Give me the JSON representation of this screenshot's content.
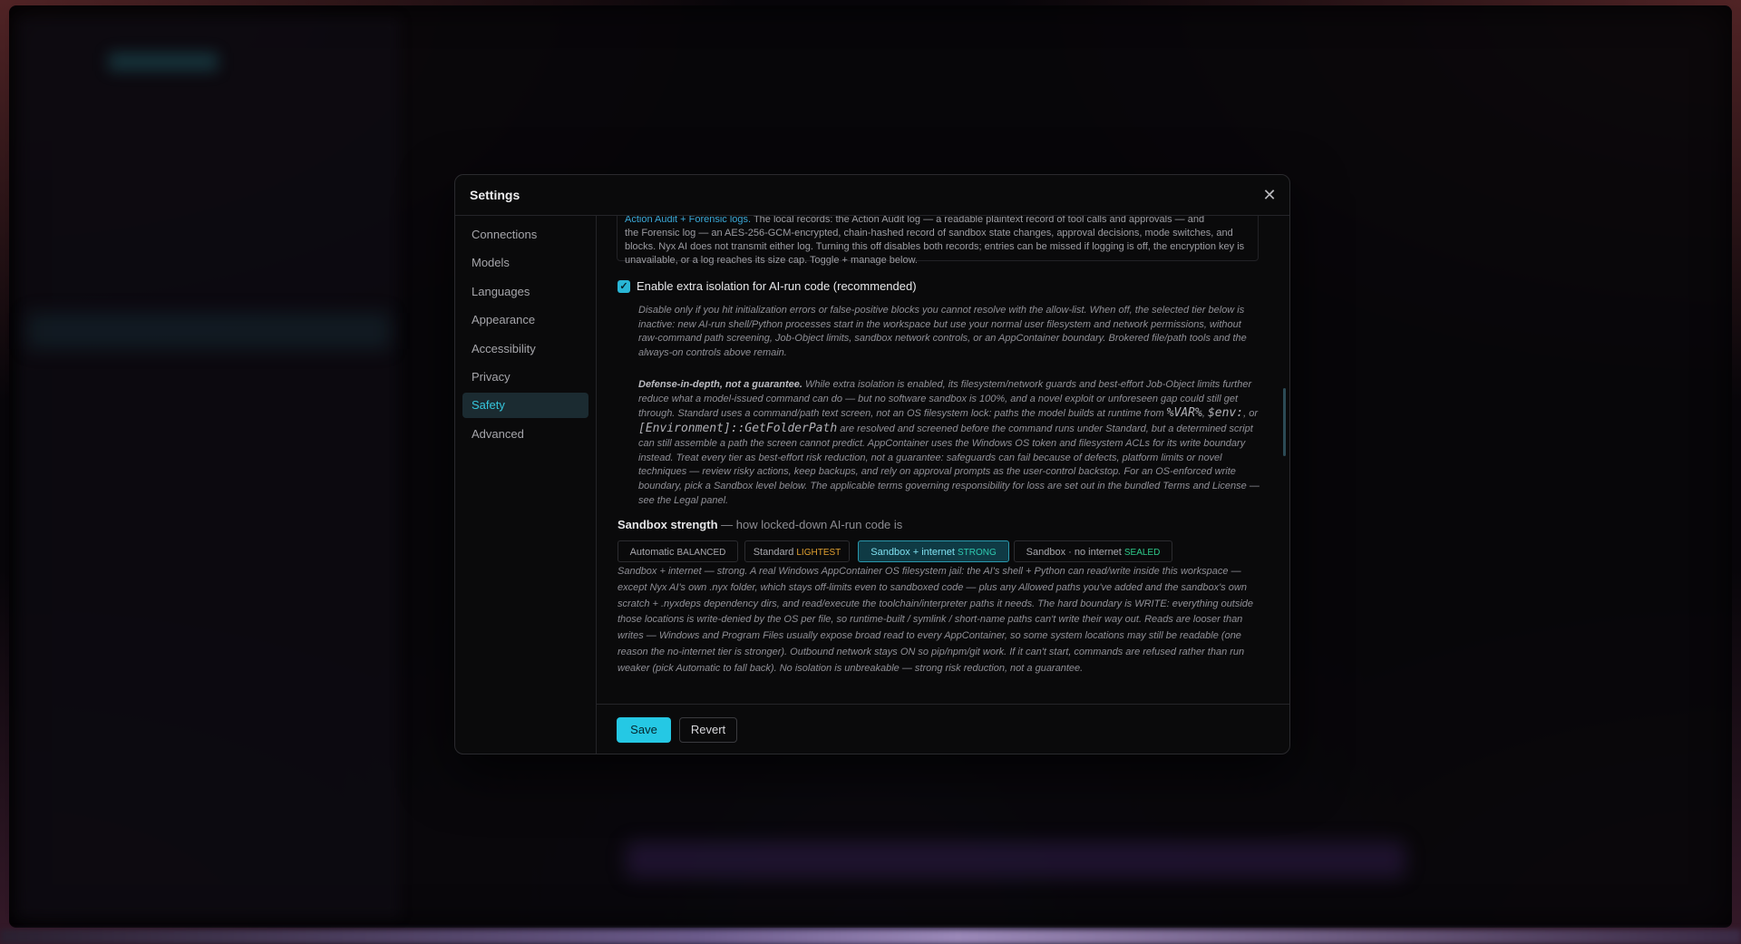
{
  "modal": {
    "title": "Settings",
    "close_glyph": "✕"
  },
  "nav": {
    "items": [
      {
        "label": "Connections"
      },
      {
        "label": "Models"
      },
      {
        "label": "Languages"
      },
      {
        "label": "Appearance"
      },
      {
        "label": "Accessibility"
      },
      {
        "label": "Privacy"
      },
      {
        "label": "Safety",
        "active": true
      },
      {
        "label": "Advanced"
      }
    ]
  },
  "safety": {
    "audit_head": "Action Audit + Forensic logs.",
    "audit_head_rest": " The local records: the Action Audit log — a readable plaintext record of tool calls and approvals — and",
    "audit_body": "the Forensic log — an AES-256-GCM-encrypted, chain-hashed record of sandbox state changes, approval decisions, mode switches, and blocks. Nyx AI does not transmit either log. Turning this off disables both records; entries can be missed if logging is off, the encryption key is unavailable, or a log reaches its size cap. Toggle + manage below.",
    "isolation_checked": true,
    "isolation_label": "Enable extra isolation for AI-run code (recommended)",
    "isolation_note": "Disable only if you hit initialization errors or false-positive blocks you cannot resolve with the allow-list. When off, the selected tier below is inactive: new AI-run shell/Python processes start in the workspace but use your normal user filesystem and network permissions, without raw-command path screening, Job-Object limits, sandbox network controls, or an AppContainer boundary. Brokered file/path tools and the always-on controls above remain.",
    "defense_title": "Defense-in-depth, not a guarantee.",
    "defense_text_1": " While extra isolation is enabled, its filesystem/network guards and best-effort Job-Object limits further reduce what a model-issued command can do — but no software sandbox is 100%, and a novel exploit or unforeseen gap could still get through. Standard uses a command/path text screen, not an OS filesystem lock: paths the model builds at runtime from ",
    "defense_code_1": "%VAR%",
    "defense_sep_1": ", ",
    "defense_code_2": "$env:",
    "defense_sep_2": ", or ",
    "defense_code_3": "[Environment]::GetFolderPath",
    "defense_text_2": " are resolved and screened before the command runs under Standard, but a determined script can still assemble a path the screen cannot predict. AppContainer uses the Windows OS token and filesystem ACLs for its write boundary instead. Treat every tier as best-effort risk reduction, not a guarantee: safeguards can fail because of defects, platform limits or novel techniques — review risky actions, keep backups, and rely on approval prompts as the user-control backstop. For an OS-enforced write boundary, pick a Sandbox level below. The applicable terms governing responsibility for loss are set out in the bundled Terms and License — see the Legal panel.",
    "strength_title": "Sandbox strength",
    "strength_sub": " — how locked-down AI-run code is",
    "tiers": [
      {
        "label": "Automatic",
        "tag": "BALANCED",
        "tag_color": "#a8a8ae"
      },
      {
        "label": "Standard",
        "tag": "LIGHTEST",
        "tag_color": "#e0a030"
      },
      {
        "label": "Sandbox + internet",
        "tag": "STRONG",
        "tag_color": "#2ec9b0",
        "active": true
      },
      {
        "label": "Sandbox · no internet",
        "tag": "SEALED",
        "tag_color": "#2ec98a"
      }
    ],
    "tier_description": "Sandbox + internet — strong. A real Windows AppContainer OS filesystem jail: the AI's shell + Python can read/write inside this workspace — except Nyx AI's own .nyx folder, which stays off-limits even to sandboxed code — plus any Allowed paths you've added and the sandbox's own scratch + .nyxdeps dependency dirs, and read/execute the toolchain/interpreter paths it needs. The hard boundary is WRITE: everything outside those locations is write-denied by the OS per file, so runtime-built / symlink / short-name paths can't write their way out. Reads are looser than writes — Windows and Program Files usually expose broad read to every AppContainer, so some system locations may still be readable (one reason the no-internet tier is stronger). Outbound network stays ON so pip/npm/git work. If it can't start, commands are refused rather than run weaker (pick Automatic to fall back). No isolation is unbreakable — strong risk reduction, not a guarantee."
  },
  "footer": {
    "save_label": "Save",
    "revert_label": "Revert"
  },
  "colors": {
    "accent": "#25c8e4",
    "active_nav_bg": "#1b2b31"
  }
}
